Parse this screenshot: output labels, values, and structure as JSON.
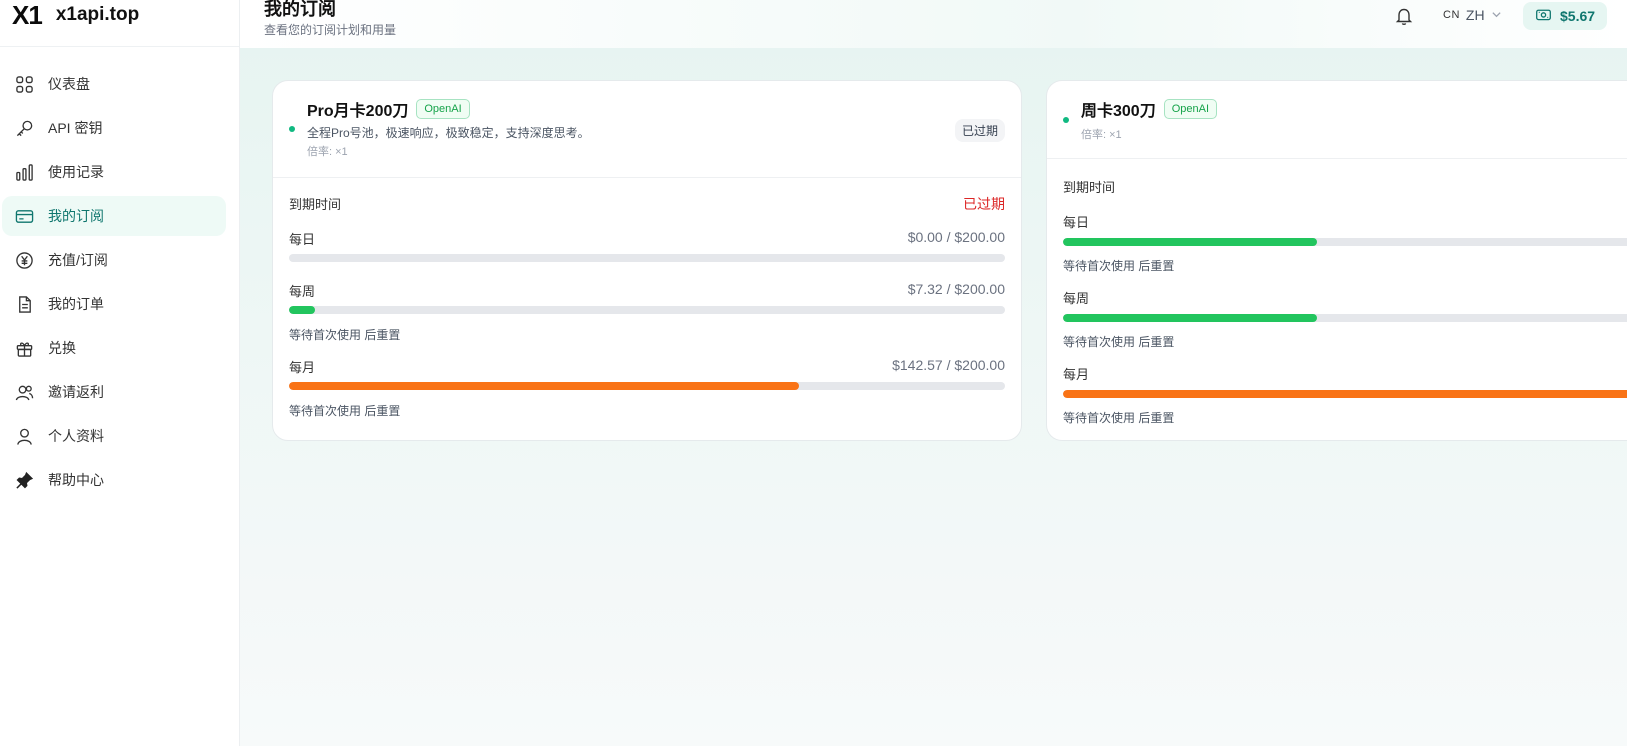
{
  "brand": {
    "logo": "X1",
    "name": "x1api.top"
  },
  "sidebar": {
    "items": [
      {
        "label": "仪表盘",
        "icon": "dashboard-icon",
        "active": false
      },
      {
        "label": "API 密钥",
        "icon": "key-icon",
        "active": false
      },
      {
        "label": "使用记录",
        "icon": "bar-chart-icon",
        "active": false
      },
      {
        "label": "我的订阅",
        "icon": "credit-card-icon",
        "active": true
      },
      {
        "label": "充值/订阅",
        "icon": "yen-circle-icon",
        "active": false
      },
      {
        "label": "我的订单",
        "icon": "document-icon",
        "active": false
      },
      {
        "label": "兑换",
        "icon": "gift-icon",
        "active": false
      },
      {
        "label": "邀请返利",
        "icon": "users-icon",
        "active": false
      },
      {
        "label": "个人资料",
        "icon": "user-icon",
        "active": false
      },
      {
        "label": "帮助中心",
        "icon": "pin-icon",
        "active": false
      }
    ]
  },
  "header": {
    "title": "我的订阅",
    "subtitle": "查看您的订阅计划和用量",
    "lang_prefix": "CN",
    "lang": "ZH",
    "balance": "$5.67"
  },
  "colors": {
    "accent": "#0f766e",
    "green": "#22c55e",
    "orange": "#f97316",
    "danger": "#dc2626"
  },
  "subscriptions": [
    {
      "name": "Pro月卡200刀",
      "tag": "OpenAI",
      "description": "全程Pro号池，极速响应，极致稳定，支持深度思考。",
      "rate": "倍率: ×1",
      "status": "已过期",
      "expire_label": "到期时间",
      "expire_value": "已过期",
      "daily": {
        "label": "每日",
        "value": "$0.00 / $200.00",
        "progress": 0
      },
      "weekly": {
        "label": "每周",
        "value": "$7.32 / $200.00",
        "progress": 0.0366,
        "note": "等待首次使用 后重置"
      },
      "monthly": {
        "label": "每月",
        "value": "$142.57 / $200.00",
        "progress": 0.7129,
        "note": "等待首次使用 后重置"
      }
    },
    {
      "name": "周卡300刀",
      "tag": "OpenAI",
      "rate": "倍率: ×1",
      "expire_label": "到期时间",
      "daily": {
        "label": "每日",
        "progress": 0.42,
        "note": "等待首次使用 后重置"
      },
      "weekly": {
        "label": "每周",
        "progress": 0.42,
        "note": "等待首次使用 后重置"
      },
      "monthly": {
        "label": "每月",
        "progress": 1.0,
        "note": "等待首次使用 后重置"
      }
    }
  ]
}
